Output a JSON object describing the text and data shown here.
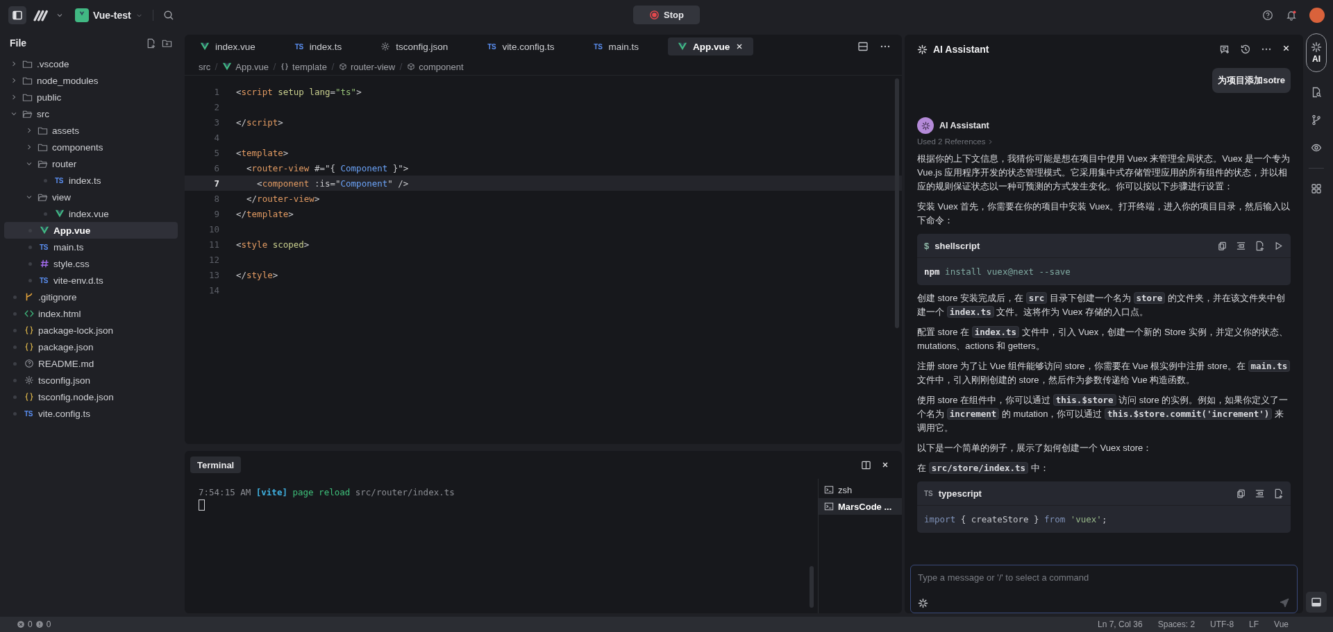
{
  "top_bar": {
    "project": "Vue-test",
    "stop_button": "Stop"
  },
  "file_panel": {
    "title": "File",
    "tree": [
      {
        "name": ".vscode",
        "kind": "folder",
        "expanded": false,
        "selected": false
      },
      {
        "name": "node_modules",
        "kind": "folder",
        "expanded": false,
        "selected": false
      },
      {
        "name": "public",
        "kind": "folder",
        "expanded": false,
        "selected": false
      },
      {
        "name": "src",
        "kind": "folder",
        "expanded": true,
        "selected": false,
        "children": [
          {
            "name": "assets",
            "kind": "folder",
            "expanded": false,
            "selected": false
          },
          {
            "name": "components",
            "kind": "folder",
            "expanded": false,
            "selected": false
          },
          {
            "name": "router",
            "kind": "folder",
            "expanded": true,
            "selected": false,
            "children": [
              {
                "name": "index.ts",
                "kind": "ts",
                "badge": "TS",
                "selected": false
              }
            ]
          },
          {
            "name": "view",
            "kind": "folder",
            "expanded": true,
            "selected": false,
            "children": [
              {
                "name": "index.vue",
                "kind": "vue",
                "selected": false
              }
            ]
          },
          {
            "name": "App.vue",
            "kind": "vue",
            "selected": true
          },
          {
            "name": "main.ts",
            "kind": "ts",
            "badge": "TS",
            "selected": false
          },
          {
            "name": "style.css",
            "kind": "css",
            "selected": false
          },
          {
            "name": "vite-env.d.ts",
            "kind": "ts",
            "badge": "TS",
            "selected": false
          }
        ]
      },
      {
        "name": ".gitignore",
        "kind": "git",
        "selected": false
      },
      {
        "name": "index.html",
        "kind": "html",
        "selected": false
      },
      {
        "name": "package-lock.json",
        "kind": "json",
        "selected": false
      },
      {
        "name": "package.json",
        "kind": "json",
        "selected": false
      },
      {
        "name": "README.md",
        "kind": "info",
        "selected": false
      },
      {
        "name": "tsconfig.json",
        "kind": "gear",
        "selected": false
      },
      {
        "name": "tsconfig.node.json",
        "kind": "json",
        "selected": false
      },
      {
        "name": "vite.config.ts",
        "kind": "ts",
        "badge": "TS",
        "selected": false
      }
    ]
  },
  "editor": {
    "tabs": [
      {
        "label": "index.vue",
        "kind": "vue",
        "selected": false
      },
      {
        "label": "index.ts",
        "kind": "ts",
        "badge": "TS",
        "selected": false
      },
      {
        "label": "tsconfig.json",
        "kind": "gear",
        "selected": false
      },
      {
        "label": "vite.config.ts",
        "kind": "ts",
        "badge": "TS",
        "selected": false
      },
      {
        "label": "main.ts",
        "kind": "ts",
        "badge": "TS",
        "selected": false
      },
      {
        "label": "App.vue",
        "kind": "vue",
        "selected": true
      }
    ],
    "breadcrumbs": [
      {
        "label": "src",
        "kind": "none"
      },
      {
        "label": "App.vue",
        "kind": "vue"
      },
      {
        "label": "template",
        "kind": "braces"
      },
      {
        "label": "router-view",
        "kind": "cube"
      },
      {
        "label": "component",
        "kind": "cube"
      }
    ],
    "lines": [
      {
        "number": "1",
        "current": false,
        "tokens": [
          {
            "text": "<",
            "kind": "punct"
          },
          {
            "text": "script",
            "kind": "tag"
          },
          {
            "text": " setup lang",
            "kind": "attr"
          },
          {
            "text": "=",
            "kind": "punct"
          },
          {
            "text": "\"ts\"",
            "kind": "string"
          },
          {
            "text": ">",
            "kind": "punct"
          }
        ]
      },
      {
        "number": "2",
        "current": false
      },
      {
        "number": "3",
        "current": false,
        "tokens": [
          {
            "text": "</",
            "kind": "punct"
          },
          {
            "text": "script",
            "kind": "tag"
          },
          {
            "text": ">",
            "kind": "punct"
          }
        ]
      },
      {
        "number": "4",
        "current": false
      },
      {
        "number": "5",
        "current": false,
        "tokens": [
          {
            "text": "<",
            "kind": "punct"
          },
          {
            "text": "template",
            "kind": "tag"
          },
          {
            "text": ">",
            "kind": "punct"
          }
        ]
      },
      {
        "number": "6",
        "current": false,
        "tokens": [
          {
            "text": "  <",
            "kind": "punct"
          },
          {
            "text": "router-view",
            "kind": "tag"
          },
          {
            "text": " #=\"{ ",
            "kind": "punct"
          },
          {
            "text": "Component",
            "kind": "var"
          },
          {
            "text": " }\">",
            "kind": "punct"
          }
        ]
      },
      {
        "number": "7",
        "current": true,
        "tokens": [
          {
            "text": "    <",
            "kind": "punct"
          },
          {
            "text": "component",
            "kind": "tag"
          },
          {
            "text": " :is=\"",
            "kind": "punct"
          },
          {
            "text": "Component",
            "kind": "var"
          },
          {
            "text": "\" />",
            "kind": "punct"
          }
        ]
      },
      {
        "number": "8",
        "current": false,
        "tokens": [
          {
            "text": "  </",
            "kind": "punct"
          },
          {
            "text": "router-view",
            "kind": "tag"
          },
          {
            "text": ">",
            "kind": "punct"
          }
        ]
      },
      {
        "number": "9",
        "current": false,
        "tokens": [
          {
            "text": "</",
            "kind": "punct"
          },
          {
            "text": "template",
            "kind": "tag"
          },
          {
            "text": ">",
            "kind": "punct"
          }
        ]
      },
      {
        "number": "10",
        "current": false
      },
      {
        "number": "11",
        "current": false,
        "tokens": [
          {
            "text": "<",
            "kind": "punct"
          },
          {
            "text": "style",
            "kind": "tag"
          },
          {
            "text": " scoped",
            "kind": "attr"
          },
          {
            "text": ">",
            "kind": "punct"
          }
        ]
      },
      {
        "number": "12",
        "current": false
      },
      {
        "number": "13",
        "current": false,
        "tokens": [
          {
            "text": "</",
            "kind": "punct"
          },
          {
            "text": "style",
            "kind": "tag"
          },
          {
            "text": ">",
            "kind": "punct"
          }
        ]
      },
      {
        "number": "14",
        "current": false
      }
    ]
  },
  "terminal": {
    "tab": "Terminal",
    "output": [
      {
        "text": "7:54:15 AM ",
        "kind": "dim"
      },
      {
        "text": "[vite]",
        "kind": "tool"
      },
      {
        "text": " page reload",
        "kind": "ok"
      },
      {
        "text": " src/router/index.ts",
        "kind": "dim"
      }
    ],
    "sessions": [
      {
        "label": "zsh",
        "selected": false
      },
      {
        "label": "MarsCode ...",
        "selected": true
      }
    ]
  },
  "ai_panel": {
    "title": "AI Assistant",
    "user_message": "为项目添加sotre",
    "assistant_name": "AI Assistant",
    "references": "Used 2 References",
    "blocks": [
      {
        "kind": "paragraph",
        "segments": [
          {
            "text": "根据你的上下文信息，我猜你可能是想在项目中使用 Vuex 来管理全局状态。Vuex 是一个专为 Vue.js 应用程序开发的状态管理模式。它采用集中式存储管理应用的所有组件的状态，并以相应的规则保证状态以一种可预测的方式发生变化。你可以按以下步骤进行设置：",
            "kind": "text"
          }
        ]
      },
      {
        "kind": "paragraph",
        "segments": [
          {
            "text": "安装 Vuex 首先，你需要在你的项目中安装 Vuex。打开终端，进入你的项目目录，然后输入以下命令：",
            "kind": "text"
          }
        ]
      },
      {
        "kind": "code",
        "badge": "$",
        "language": "shellscript",
        "run": true,
        "tokens": [
          {
            "text": "npm",
            "kind": "cmd"
          },
          {
            "text": " install vuex@next --save",
            "kind": "arg"
          }
        ]
      },
      {
        "kind": "paragraph",
        "segments": [
          {
            "text": "创建 store 安装完成后，在 ",
            "kind": "text"
          },
          {
            "text": "src",
            "kind": "code"
          },
          {
            "text": " 目录下创建一个名为 ",
            "kind": "text"
          },
          {
            "text": "store",
            "kind": "code"
          },
          {
            "text": " 的文件夹，并在该文件夹中创建一个 ",
            "kind": "text"
          },
          {
            "text": "index.ts",
            "kind": "code"
          },
          {
            "text": " 文件。这将作为 Vuex 存储的入口点。",
            "kind": "text"
          }
        ]
      },
      {
        "kind": "paragraph",
        "segments": [
          {
            "text": "配置 store 在 ",
            "kind": "text"
          },
          {
            "text": "index.ts",
            "kind": "code"
          },
          {
            "text": " 文件中，引入 Vuex，创建一个新的 Store 实例，并定义你的状态、 mutations、actions 和 getters。",
            "kind": "text"
          }
        ]
      },
      {
        "kind": "paragraph",
        "segments": [
          {
            "text": "注册 store 为了让 Vue 组件能够访问 store，你需要在 Vue 根实例中注册 store。在 ",
            "kind": "text"
          },
          {
            "text": "main.ts",
            "kind": "code"
          },
          {
            "text": " 文件中，引入刚刚创建的 store，然后作为参数传递给 Vue 构造函数。",
            "kind": "text"
          }
        ]
      },
      {
        "kind": "paragraph",
        "segments": [
          {
            "text": "使用 store 在组件中，你可以通过 ",
            "kind": "text"
          },
          {
            "text": "this.$store",
            "kind": "code"
          },
          {
            "text": " 访问 store 的实例。例如，如果你定义了一个名为 ",
            "kind": "text"
          },
          {
            "text": "increment",
            "kind": "code"
          },
          {
            "text": " 的 mutation，你可以通过 ",
            "kind": "text"
          },
          {
            "text": "this.$store.commit('increment')",
            "kind": "code"
          },
          {
            "text": " 来调用它。",
            "kind": "text"
          }
        ]
      },
      {
        "kind": "paragraph",
        "segments": [
          {
            "text": "以下是一个简单的例子，展示了如何创建一个 Vuex store：",
            "kind": "text"
          }
        ]
      },
      {
        "kind": "paragraph",
        "segments": [
          {
            "text": "在 ",
            "kind": "text"
          },
          {
            "text": "src/store/index.ts",
            "kind": "code"
          },
          {
            "text": " 中：",
            "kind": "text"
          }
        ]
      },
      {
        "kind": "code",
        "badge": "TS",
        "language": "typescript",
        "run": false,
        "tokens": [
          {
            "text": "import",
            "kind": "kw"
          },
          {
            "text": " { createStore } ",
            "kind": "plain"
          },
          {
            "text": "from",
            "kind": "kw"
          },
          {
            "text": " 'vuex'",
            "kind": "str"
          },
          {
            "text": ";",
            "kind": "plain"
          }
        ]
      }
    ],
    "input": {
      "placeholder": "Type a message or '/' to select a command"
    }
  },
  "activity_bar": [
    {
      "kind": "ai",
      "label": "AI",
      "selected": true
    },
    {
      "kind": "file-search",
      "selected": false
    },
    {
      "kind": "branch",
      "selected": false
    },
    {
      "kind": "eye",
      "selected": false
    },
    {
      "kind": "grid",
      "selected": false
    }
  ],
  "status_bar": {
    "errors": "0",
    "warnings": "0",
    "items": [
      "Ln 7, Col 36",
      "Spaces: 2",
      "UTF-8",
      "LF",
      "Vue"
    ]
  }
}
